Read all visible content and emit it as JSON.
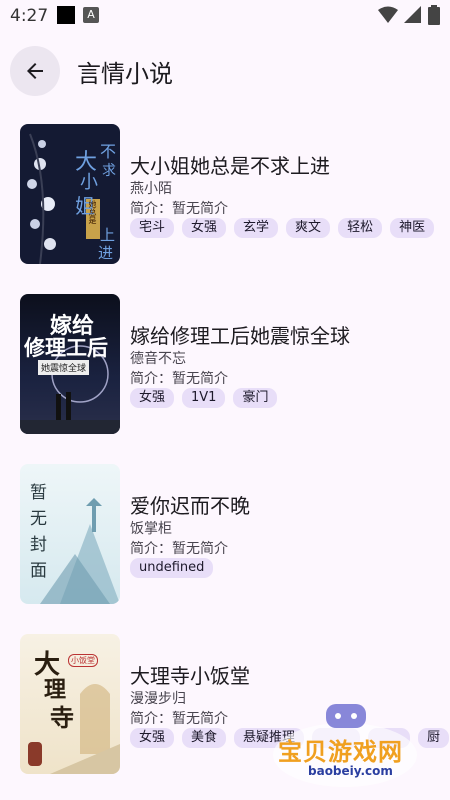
{
  "status_bar": {
    "time": "4:27",
    "a_icon": "A"
  },
  "app_bar": {
    "title": "言情小说"
  },
  "books": [
    {
      "title": "大小姐她总是不求上进",
      "author": "燕小陌",
      "intro": "简介：暂无简介",
      "tags": [
        "宅斗",
        "女强",
        "玄学",
        "爽文",
        "轻松",
        "神医"
      ],
      "cover_text": [
        "大",
        "小",
        "姐",
        "不",
        "求",
        "上",
        "进"
      ],
      "cover_sub": "她总是"
    },
    {
      "title": "嫁给修理工后她震惊全球",
      "author": "德音不忘",
      "intro": "简介：暂无简介",
      "tags": [
        "女强",
        "1V1",
        "豪门"
      ],
      "cover_text": [
        "嫁给",
        "修理工后"
      ],
      "cover_sub": "她震惊全球"
    },
    {
      "title": "爱你迟而不晚",
      "author": "饭掌柜",
      "intro": "简介：暂无简介",
      "tags": [
        "undefined"
      ],
      "cover_text": [
        "暂",
        "无",
        "封",
        "面"
      ]
    },
    {
      "title": "大理寺小饭堂",
      "author": "漫漫步归",
      "intro": "简介：暂无简介",
      "tags": [
        "女强",
        "美食",
        "悬疑推理",
        "",
        "",
        "厨"
      ],
      "cover_text": [
        "大",
        "理",
        "寺"
      ],
      "cover_sub": "小饭堂"
    }
  ],
  "watermark": {
    "name": "宝贝游戏网",
    "url": "baobeiy.com"
  },
  "colors": {
    "background": "#fdf7fe",
    "tag": "#e8def8",
    "back_button": "#ece6f0"
  }
}
